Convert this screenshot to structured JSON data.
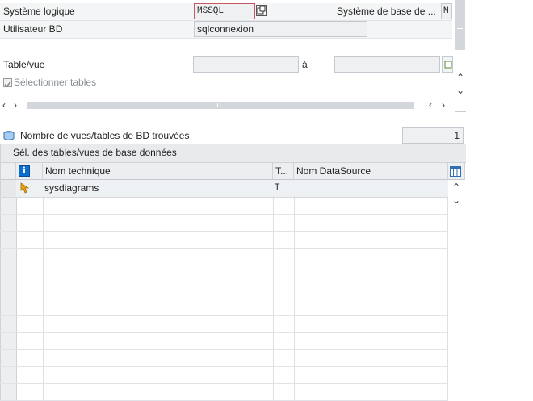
{
  "form": {
    "logical_system_label": "Système logique",
    "logical_system_value": "MSSQL",
    "base_system_label": "Système de base de ...",
    "base_system_value": "M",
    "user_label": "Utilisateur BD",
    "user_value": "sqlconnexion",
    "table_label": "Table/vue",
    "table_from_value": "",
    "range_to_label": "à",
    "table_to_value": "",
    "select_tables_label": "Sélectionner tables",
    "select_tables_checked": true
  },
  "summary": {
    "count_label": "Nombre de vues/tables de BD trouvées",
    "count_value": "1"
  },
  "table": {
    "title": "Sél. des tables/vues de base données",
    "columns": [
      "",
      "Nom technique",
      "T...",
      "Nom DataSource"
    ],
    "rows": [
      {
        "name": "sysdiagrams",
        "type": "T",
        "datasource": ""
      }
    ]
  },
  "colors": {
    "field_bg": "#eef0f2",
    "header_bg": "#eceef0",
    "accent": "#0a6ed1",
    "hot_icon": "#e8a317"
  }
}
